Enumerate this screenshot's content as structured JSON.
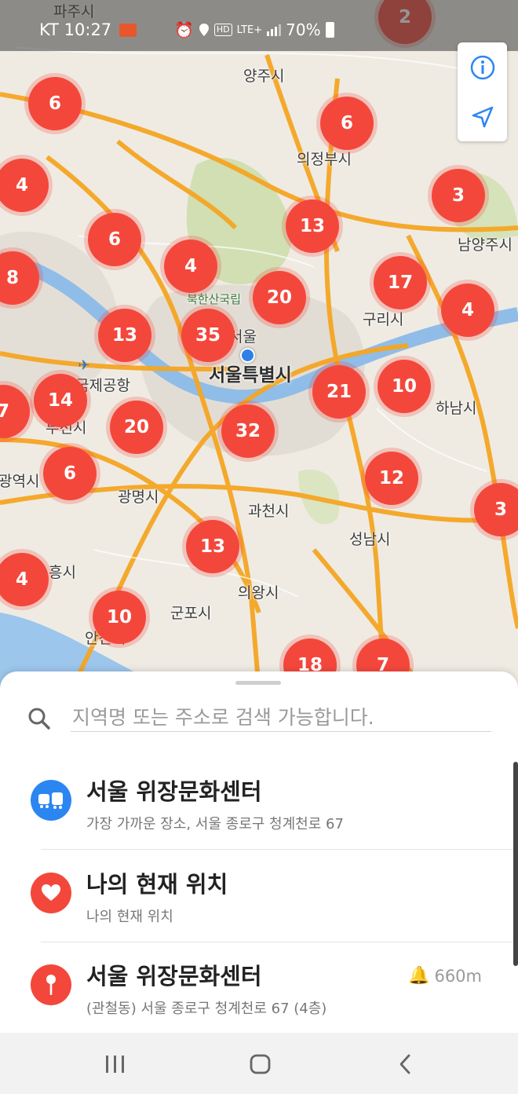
{
  "status_bar": {
    "carrier_time": "KT 10:27",
    "network_badge": "HD",
    "lte": "LTE+",
    "battery": "70%"
  },
  "map": {
    "places": [
      {
        "name": "파주시",
        "cls": ""
      },
      {
        "name": "양주시",
        "cls": ""
      },
      {
        "name": "의정부시",
        "cls": ""
      },
      {
        "name": "남양주시",
        "cls": ""
      },
      {
        "name": "북한산국립",
        "cls": "green"
      },
      {
        "name": "서울",
        "cls": ""
      },
      {
        "name": "구리시",
        "cls": ""
      },
      {
        "name": "서울특별시",
        "cls": "big"
      },
      {
        "name": "국제공항",
        "cls": ""
      },
      {
        "name": "부천시",
        "cls": ""
      },
      {
        "name": "하남시",
        "cls": ""
      },
      {
        "name": "광역시",
        "cls": ""
      },
      {
        "name": "광명시",
        "cls": ""
      },
      {
        "name": "과천시",
        "cls": ""
      },
      {
        "name": "성남시",
        "cls": ""
      },
      {
        "name": "흥시",
        "cls": ""
      },
      {
        "name": "의왕시",
        "cls": ""
      },
      {
        "name": "군포시",
        "cls": ""
      },
      {
        "name": "안산시",
        "cls": ""
      }
    ],
    "clusters": [
      "2",
      "6",
      "6",
      "4",
      "3",
      "13",
      "6",
      "4",
      "8",
      "20",
      "17",
      "4",
      "13",
      "35",
      "21",
      "10",
      "7",
      "14",
      "20",
      "32",
      "6",
      "12",
      "3",
      "13",
      "4",
      "10",
      "18",
      "7"
    ]
  },
  "map_buttons": {
    "info_icon": "info-icon",
    "locate_icon": "navigation-arrow-icon"
  },
  "sheet": {
    "search_placeholder": "지역명 또는 주소로 검색 가능합니다.",
    "items": [
      {
        "title": "서울 위장문화센터",
        "subtitle": "가장 가까운 장소, 서울 종로구 청계천로 67",
        "icon": "transit-icon",
        "color": "#2c86f2",
        "distance": ""
      },
      {
        "title": "나의 현재 위치",
        "subtitle": "나의 현재 위치",
        "icon": "heart-icon",
        "color": "#f4473c",
        "distance": ""
      },
      {
        "title": "서울 위장문화센터",
        "subtitle": "(관철동) 서울 종로구 청계천로 67 (4층)",
        "icon": "map-pin-icon",
        "color": "#f4473c",
        "distance": "660m"
      }
    ]
  },
  "navbar": {
    "recent": "recent-apps-icon",
    "home": "home-icon",
    "back": "back-icon"
  }
}
